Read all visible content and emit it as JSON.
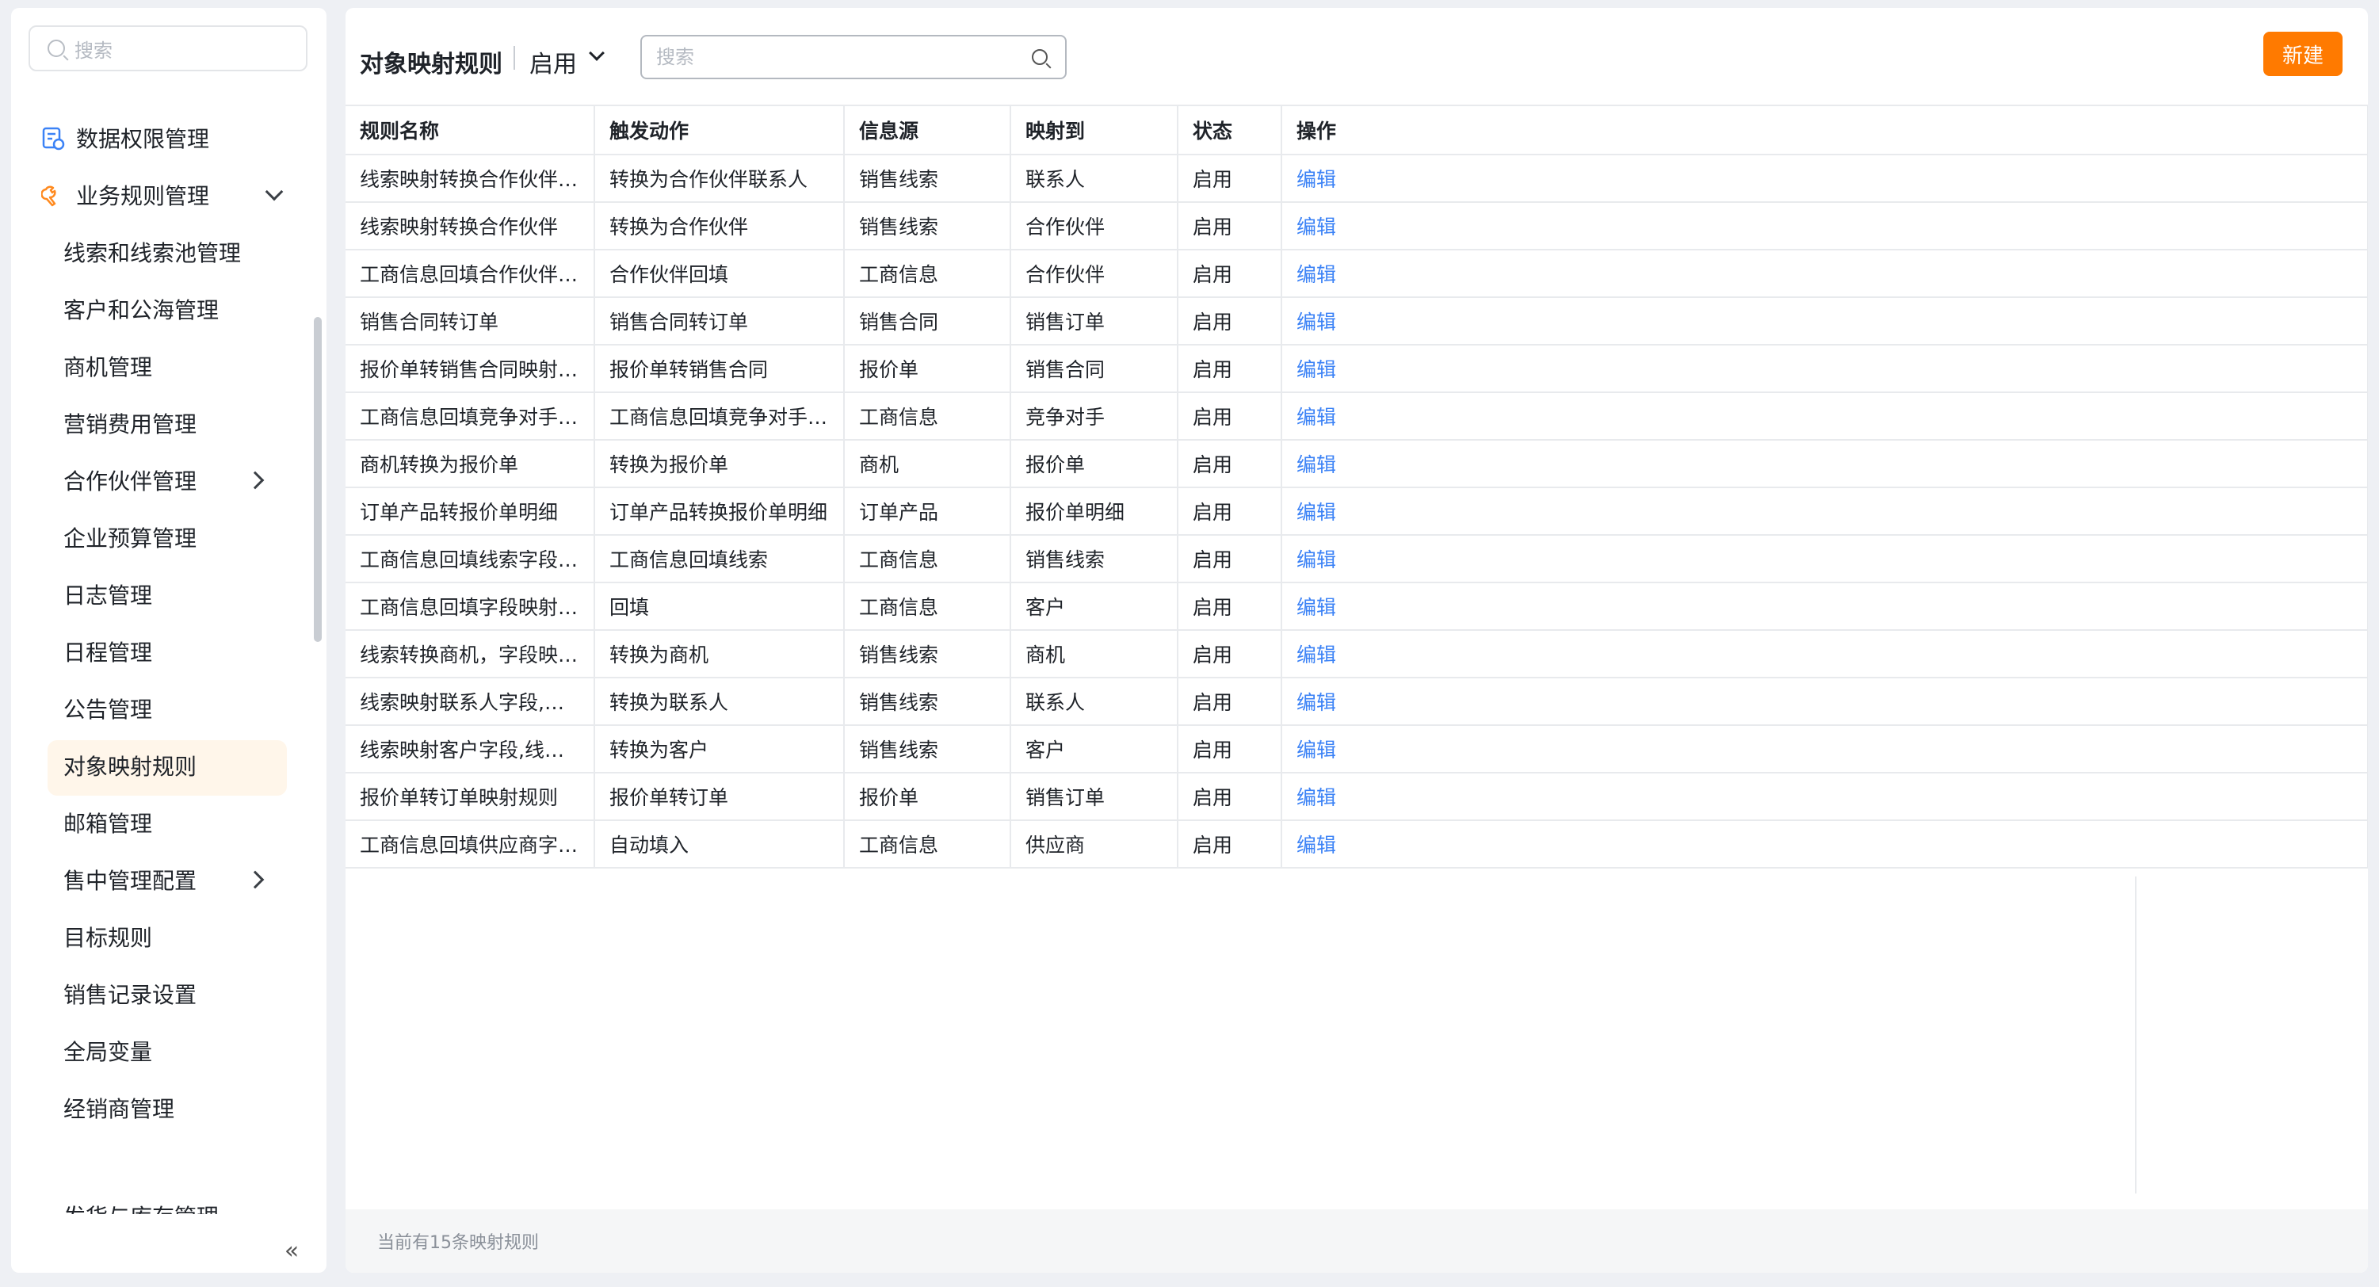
{
  "sidebar": {
    "search_placeholder": "搜索",
    "items": [
      {
        "label": "数据权限管理",
        "level": "top",
        "icon": "data-permission-icon"
      },
      {
        "label": "业务规则管理",
        "level": "top",
        "icon": "wrench-icon",
        "expanded": true
      },
      {
        "label": "线索和线索池管理",
        "level": "sub"
      },
      {
        "label": "客户和公海管理",
        "level": "sub"
      },
      {
        "label": "商机管理",
        "level": "sub"
      },
      {
        "label": "营销费用管理",
        "level": "sub"
      },
      {
        "label": "合作伙伴管理",
        "level": "sub",
        "has_children": true
      },
      {
        "label": "企业预算管理",
        "level": "sub"
      },
      {
        "label": "日志管理",
        "level": "sub"
      },
      {
        "label": "日程管理",
        "level": "sub"
      },
      {
        "label": "公告管理",
        "level": "sub"
      },
      {
        "label": "对象映射规则",
        "level": "sub",
        "active": true
      },
      {
        "label": "邮箱管理",
        "level": "sub"
      },
      {
        "label": "售中管理配置",
        "level": "sub",
        "has_children": true
      },
      {
        "label": "目标规则",
        "level": "sub"
      },
      {
        "label": "销售记录设置",
        "level": "sub"
      },
      {
        "label": "全局变量",
        "level": "sub"
      },
      {
        "label": "经销商管理",
        "level": "sub"
      },
      {
        "label": "发货与库存管理",
        "level": "sub",
        "has_children": true
      }
    ],
    "collapse_icon": "«"
  },
  "header": {
    "title": "对象映射规则",
    "status_filter": "启用",
    "search_placeholder": "搜索",
    "new_button": "新建"
  },
  "table": {
    "columns": [
      "规则名称",
      "触发动作",
      "信息源",
      "映射到",
      "状态",
      "操作"
    ],
    "rows": [
      [
        "线索映射转换合作伙伴联系人",
        "转换为合作伙伴联系人",
        "销售线索",
        "联系人",
        "启用",
        "编辑"
      ],
      [
        "线索映射转换合作伙伴",
        "转换为合作伙伴",
        "销售线索",
        "合作伙伴",
        "启用",
        "编辑"
      ],
      [
        "工商信息回填合作伙伴字段映射规则",
        "合作伙伴回填",
        "工商信息",
        "合作伙伴",
        "启用",
        "编辑"
      ],
      [
        "销售合同转订单",
        "销售合同转订单",
        "销售合同",
        "销售订单",
        "启用",
        "编辑"
      ],
      [
        "报价单转销售合同映射规则",
        "报价单转销售合同",
        "报价单",
        "销售合同",
        "启用",
        "编辑"
      ],
      [
        "工商信息回填竞争对手字段映射规则",
        "工商信息回填竞争对手字段映射规则",
        "工商信息",
        "竞争对手",
        "启用",
        "编辑"
      ],
      [
        "商机转换为报价单",
        "转换为报价单",
        "商机",
        "报价单",
        "启用",
        "编辑"
      ],
      [
        "订单产品转报价单明细",
        "订单产品转换报价单明细",
        "订单产品",
        "报价单明细",
        "启用",
        "编辑"
      ],
      [
        "工商信息回填线索字段映射规则",
        "工商信息回填线索",
        "工商信息",
        "销售线索",
        "启用",
        "编辑"
      ],
      [
        "工商信息回填字段映射规则",
        "回填",
        "工商信息",
        "客户",
        "启用",
        "编辑"
      ],
      [
        "线索转换商机，字段映射规则",
        "转换为商机",
        "销售线索",
        "商机",
        "启用",
        "编辑"
      ],
      [
        "线索映射联系人字段,线索转换时自动带入映射字段",
        "转换为联系人",
        "销售线索",
        "联系人",
        "启用",
        "编辑"
      ],
      [
        "线索映射客户字段,线索转换时自动带入映射字段",
        "转换为客户",
        "销售线索",
        "客户",
        "启用",
        "编辑"
      ],
      [
        "报价单转订单映射规则",
        "报价单转订单",
        "报价单",
        "销售订单",
        "启用",
        "编辑"
      ],
      [
        "工商信息回填供应商字段映射规则",
        "自动填入",
        "工商信息",
        "供应商",
        "启用",
        "编辑"
      ]
    ]
  },
  "footer": {
    "summary": "当前有15条映射规则"
  },
  "colors": {
    "accent": "#ff7a00",
    "link": "#3b82f6",
    "active_bg": "#fff6ea"
  }
}
